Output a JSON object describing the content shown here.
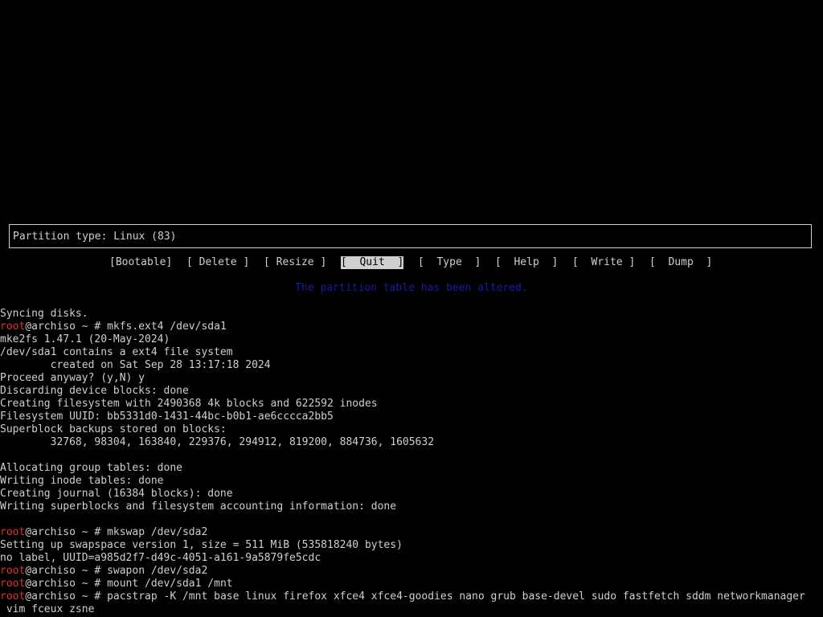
{
  "cfdisk": {
    "partition_type": "Partition type: Linux (83)",
    "menu": [
      "[Bootable]",
      "[ Delete ]",
      "[ Resize ]",
      "[  Quit  ]",
      "[  Type  ]",
      "[  Help  ]",
      "[  Write ]",
      "[  Dump  ]"
    ],
    "selected_index": 3,
    "status": "The partition table has been altered."
  },
  "terminal": {
    "lines": [
      {
        "prompt_user": "",
        "prompt_rest": "",
        "text": "Syncing disks."
      },
      {
        "prompt_user": "root",
        "prompt_rest": "@archiso ~ # ",
        "text": "mkfs.ext4 /dev/sda1"
      },
      {
        "prompt_user": "",
        "prompt_rest": "",
        "text": "mke2fs 1.47.1 (20-May-2024)"
      },
      {
        "prompt_user": "",
        "prompt_rest": "",
        "text": "/dev/sda1 contains a ext4 file system"
      },
      {
        "prompt_user": "",
        "prompt_rest": "",
        "text": "        created on Sat Sep 28 13:17:18 2024"
      },
      {
        "prompt_user": "",
        "prompt_rest": "",
        "text": "Proceed anyway? (y,N) y"
      },
      {
        "prompt_user": "",
        "prompt_rest": "",
        "text": "Discarding device blocks: done"
      },
      {
        "prompt_user": "",
        "prompt_rest": "",
        "text": "Creating filesystem with 2490368 4k blocks and 622592 inodes"
      },
      {
        "prompt_user": "",
        "prompt_rest": "",
        "text": "Filesystem UUID: bb5331d0-1431-44bc-b0b1-ae6cccca2bb5"
      },
      {
        "prompt_user": "",
        "prompt_rest": "",
        "text": "Superblock backups stored on blocks:"
      },
      {
        "prompt_user": "",
        "prompt_rest": "",
        "text": "        32768, 98304, 163840, 229376, 294912, 819200, 884736, 1605632"
      },
      {
        "prompt_user": "",
        "prompt_rest": "",
        "text": ""
      },
      {
        "prompt_user": "",
        "prompt_rest": "",
        "text": "Allocating group tables: done"
      },
      {
        "prompt_user": "",
        "prompt_rest": "",
        "text": "Writing inode tables: done"
      },
      {
        "prompt_user": "",
        "prompt_rest": "",
        "text": "Creating journal (16384 blocks): done"
      },
      {
        "prompt_user": "",
        "prompt_rest": "",
        "text": "Writing superblocks and filesystem accounting information: done"
      },
      {
        "prompt_user": "",
        "prompt_rest": "",
        "text": ""
      },
      {
        "prompt_user": "root",
        "prompt_rest": "@archiso ~ # ",
        "text": "mkswap /dev/sda2"
      },
      {
        "prompt_user": "",
        "prompt_rest": "",
        "text": "Setting up swapspace version 1, size = 511 MiB (535818240 bytes)"
      },
      {
        "prompt_user": "",
        "prompt_rest": "",
        "text": "no label, UUID=a985d2f7-d49c-4051-a161-9a5879fe5cdc"
      },
      {
        "prompt_user": "root",
        "prompt_rest": "@archiso ~ # ",
        "text": "swapon /dev/sda2"
      },
      {
        "prompt_user": "root",
        "prompt_rest": "@archiso ~ # ",
        "text": "mount /dev/sda1 /mnt"
      },
      {
        "prompt_user": "root",
        "prompt_rest": "@archiso ~ # ",
        "text": "pacstrap -K /mnt base linux firefox xfce4 xfce4-goodies nano grub base-devel sudo fastfetch sddm networkmanager"
      },
      {
        "prompt_user": "",
        "prompt_rest": "",
        "text": " vim fceux zsne"
      }
    ]
  },
  "colors": {
    "background": "#000000",
    "foreground": "#cfcfcf",
    "prompt_user": "#e03030",
    "status": "#1a1aa8"
  }
}
